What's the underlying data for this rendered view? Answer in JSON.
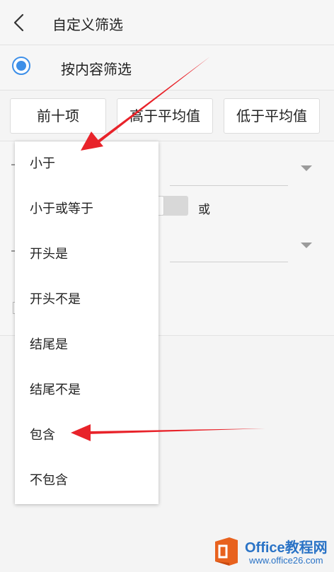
{
  "header": {
    "title": "自定义筛选",
    "back_icon": "chevron-left-icon"
  },
  "filter_mode": {
    "label": "按内容筛选",
    "selected": true,
    "accent": "#3d8fe8"
  },
  "quick_buttons": [
    {
      "label": "前十项"
    },
    {
      "label": "高于平均值"
    },
    {
      "label": "低于平均值"
    }
  ],
  "criteria": {
    "logic_or_label": "或"
  },
  "dropdown": {
    "options": [
      {
        "label": "小于"
      },
      {
        "label": "小于或等于"
      },
      {
        "label": "开头是"
      },
      {
        "label": "开头不是"
      },
      {
        "label": "结尾是"
      },
      {
        "label": "结尾不是"
      },
      {
        "label": "包含"
      },
      {
        "label": "不包含"
      }
    ]
  },
  "annotation": {
    "arrow_color": "#e8232a"
  },
  "watermark": {
    "brand_prefix": "Office",
    "brand_suffix": "教程网",
    "site": "www.office26.com",
    "logo_color": "#e8621e"
  }
}
